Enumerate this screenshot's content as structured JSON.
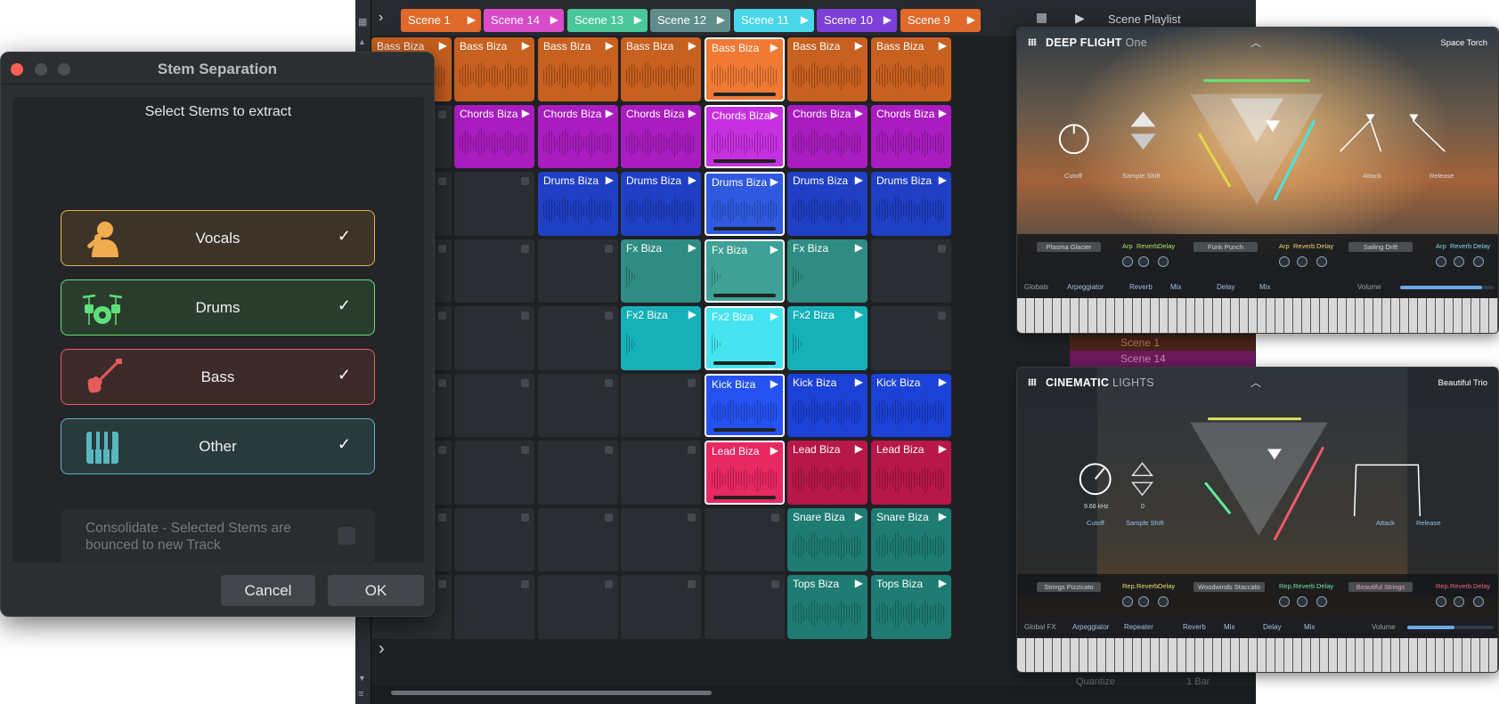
{
  "daw": {
    "scenes": [
      {
        "label": "Scene 1",
        "color": "#e06a2b"
      },
      {
        "label": "Scene 14",
        "color": "#d94ac9"
      },
      {
        "label": "Scene 13",
        "color": "#49c79a"
      },
      {
        "label": "Scene 12",
        "color": "#5e8d8c"
      },
      {
        "label": "Scene 11",
        "color": "#4ad6ea"
      },
      {
        "label": "Scene 10",
        "color": "#7d3fd7"
      },
      {
        "label": "Scene 9",
        "color": "#e06a2b"
      }
    ],
    "playlist_title": "Scene Playlist",
    "rows": [
      {
        "name": "Bass Biza",
        "color": "#c8601f",
        "cols": [
          0,
          1,
          2,
          3,
          4,
          5,
          6
        ],
        "active": 4
      },
      {
        "name": "Chords Biza",
        "color": "#a91cbf",
        "cols": [
          1,
          2,
          3,
          4,
          5,
          6
        ],
        "active": 4
      },
      {
        "name": "Drums Biza",
        "color": "#1f3fc4",
        "cols": [
          2,
          3,
          4,
          5,
          6
        ],
        "active": 4
      },
      {
        "name": "Fx Biza",
        "color": "#2f8c83",
        "cols": [
          3,
          4,
          5
        ],
        "active": 4
      },
      {
        "name": "Fx2 Biza",
        "color": "#16b0b8",
        "cols": [
          3,
          4,
          5
        ],
        "active": 4
      },
      {
        "name": "Kick Biza",
        "color": "#1c41d6",
        "cols": [
          4,
          5,
          6
        ],
        "active": 4
      },
      {
        "name": "Lead Biza",
        "color": "#b8174a",
        "cols": [
          4,
          5,
          6
        ],
        "active": 4
      },
      {
        "name": "Snare Biza",
        "color": "#1e7c73",
        "cols": [
          5,
          6
        ],
        "active": -1
      },
      {
        "name": "Tops Biza",
        "color": "#1e7c73",
        "cols": [
          5,
          6
        ],
        "active": -1
      }
    ],
    "side_panel": {
      "scenes": [
        "Scene 1",
        "Scene 14"
      ],
      "quantize_label": "Quantize",
      "quantize_value": "1 Bar"
    }
  },
  "dialog": {
    "title": "Stem Separation",
    "subtitle": "Select Stems to extract",
    "stems": [
      {
        "label": "Vocals",
        "icon": "vocalist-icon",
        "color": "#f0ac4e",
        "bg": "#3d3427",
        "checked": true
      },
      {
        "label": "Drums",
        "icon": "drum-kit-icon",
        "color": "#5fe07a",
        "bg": "#2a3d2d",
        "checked": true
      },
      {
        "label": "Bass",
        "icon": "bass-guitar-icon",
        "color": "#e85a5a",
        "bg": "#3d2a2b",
        "checked": true
      },
      {
        "label": "Other",
        "icon": "piano-keys-icon",
        "color": "#59b7c0",
        "bg": "#293a3c",
        "checked": true
      }
    ],
    "consolidate_label": "Consolidate - Selected Stems are bounced to new Track",
    "consolidate_checked": false,
    "cancel_label": "Cancel",
    "ok_label": "OK",
    "check_glyph": "✓"
  },
  "synth1": {
    "name_bold": "DEEP FLIGHT",
    "name_light": "One",
    "preset": "Space Torch",
    "knobs": [
      {
        "label": "Cutoff"
      },
      {
        "label": "Sample Shift"
      },
      {
        "label": "Attack"
      },
      {
        "label": "Release"
      }
    ],
    "slots": [
      "Plasma Glacier",
      "Funk Punch",
      "Sailing Drift"
    ],
    "fx": [
      "Arp",
      "Reverb",
      "Delay"
    ],
    "globals": {
      "label": "Globals",
      "arp": "Arpeggiator",
      "reverb": "Reverb",
      "mix": "Mix",
      "delay": "Delay",
      "volume": "Volume"
    }
  },
  "synth2": {
    "name_bold": "CINEMATIC",
    "name_light": "LIGHTS",
    "preset": "Beautiful Trio",
    "cutoff_value": "9.68 kHz",
    "shift_value": "0",
    "knobs": [
      {
        "label": "Cutoff"
      },
      {
        "label": "Sample Shift"
      },
      {
        "label": "Attack"
      },
      {
        "label": "Release"
      }
    ],
    "slots": [
      "Strings Pizzicato",
      "Woodwinds Staccato",
      "Beautiful Strings"
    ],
    "fx": [
      "Rep.",
      "Reverb",
      "Delay"
    ],
    "globals": {
      "label": "Global FX",
      "arp": "Arpeggiator",
      "rep": "Repeater",
      "reverb": "Reverb",
      "mix": "Mix",
      "delay": "Delay",
      "volume": "Volume"
    }
  }
}
